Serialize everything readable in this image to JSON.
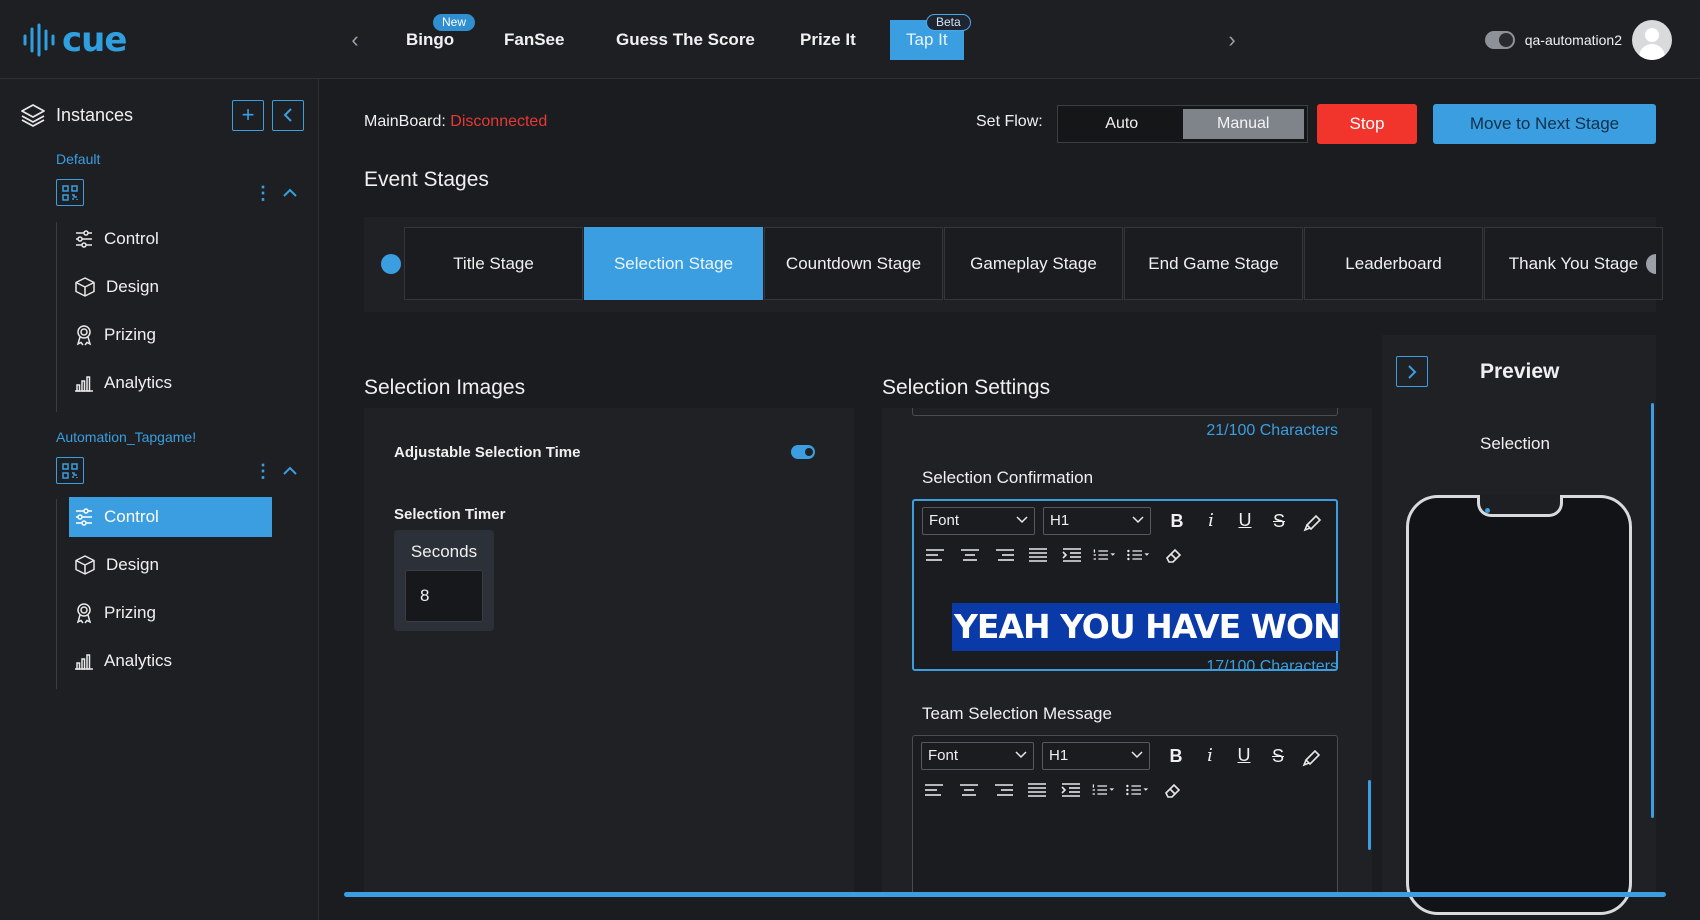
{
  "brand": {
    "name": "cue",
    "accent": "#3a9ee0"
  },
  "nav": {
    "tabs": [
      {
        "label": "Bingo",
        "badge": "New"
      },
      {
        "label": "FanSee"
      },
      {
        "label": "Guess The Score"
      },
      {
        "label": "Prize It"
      },
      {
        "label": "Tap It",
        "badge": "Beta",
        "active": true
      }
    ],
    "prev_icon": "chevron-left-icon",
    "next_icon": "chevron-right-icon"
  },
  "user": {
    "name": "qa-automation2",
    "avatar_icon": "user-avatar-icon"
  },
  "sidebar": {
    "title": "Instances",
    "groups": [
      {
        "name": "Default",
        "items": [
          {
            "label": "Control",
            "icon": "sliders-icon"
          },
          {
            "label": "Design",
            "icon": "cube-icon"
          },
          {
            "label": "Prizing",
            "icon": "award-icon"
          },
          {
            "label": "Analytics",
            "icon": "bar-chart-icon"
          }
        ]
      },
      {
        "name": "Automation_Tapgame!",
        "items": [
          {
            "label": "Control",
            "icon": "sliders-icon",
            "active": true
          },
          {
            "label": "Design",
            "icon": "cube-icon"
          },
          {
            "label": "Prizing",
            "icon": "award-icon"
          },
          {
            "label": "Analytics",
            "icon": "bar-chart-icon"
          }
        ]
      }
    ]
  },
  "header": {
    "mainboard_label": "MainBoard:",
    "mainboard_status": "Disconnected",
    "status_color": "#e53935",
    "flow_label": "Set Flow:",
    "flow_options": [
      "Auto",
      "Manual"
    ],
    "flow_selected": "Manual",
    "stop_label": "Stop",
    "next_label": "Move to Next Stage"
  },
  "stages": {
    "title": "Event Stages",
    "items": [
      "Title Stage",
      "Selection Stage",
      "Countdown Stage",
      "Gameplay Stage",
      "End Game Stage",
      "Leaderboard",
      "Thank You Stage"
    ],
    "active": "Selection Stage"
  },
  "images": {
    "title": "Selection Images",
    "adjustable_label": "Adjustable Selection Time",
    "adjustable_on": true,
    "timer_label": "Selection Timer",
    "timer_unit": "Seconds",
    "timer_value": "8"
  },
  "settings": {
    "title": "Selection Settings",
    "prev_count": "21/100 Characters",
    "confirmation": {
      "label": "Selection Confirmation",
      "font": "Font",
      "heading": "H1",
      "text": "YEAH YOU HAVE WON",
      "count": "17/100 Characters"
    },
    "team": {
      "label": "Team Selection Message",
      "font": "Font",
      "heading": "H1"
    }
  },
  "preview": {
    "title": "Preview",
    "subtitle": "Selection"
  }
}
